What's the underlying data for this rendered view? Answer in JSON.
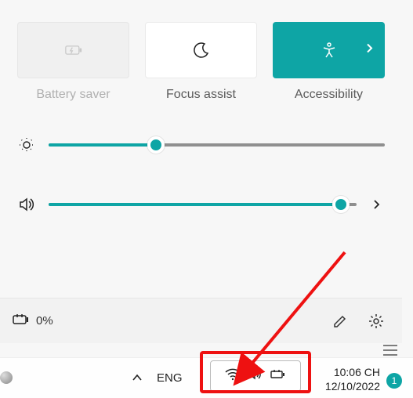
{
  "accent_color": "#0ea5a5",
  "tiles": {
    "battery_saver": {
      "label": "Battery saver"
    },
    "focus_assist": {
      "label": "Focus assist"
    },
    "accessibility": {
      "label": "Accessibility"
    }
  },
  "sliders": {
    "brightness_percent": 32,
    "volume_percent": 95
  },
  "status": {
    "battery_text": "0%"
  },
  "taskbar": {
    "language": "ENG",
    "time": "10:06 CH",
    "date": "12/10/2022",
    "notification_count": "1"
  }
}
